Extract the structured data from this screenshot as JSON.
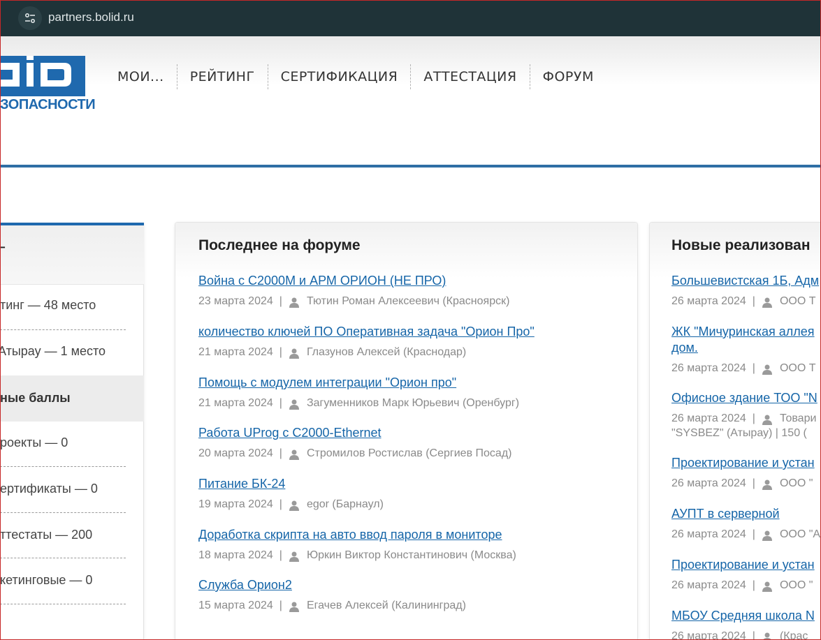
{
  "browser": {
    "url": "partners.bolid.ru"
  },
  "header": {
    "logo_letters": "LID",
    "logo_tagline": "ЗОПАСНОСТИ",
    "nav": [
      "МОИ...",
      "РЕЙТИНГ",
      "СЕРТИФИКАЦИЯ",
      "АТТЕСТАЦИЯ",
      "ФОРУМ"
    ]
  },
  "left_panel": {
    "title": "Г",
    "rows": [
      "тинг — 48 место",
      "Атырау — 1 место"
    ],
    "section": "ные баллы",
    "points": [
      "роекты — 0",
      "ертификаты — 0",
      "ттестаты — 200",
      "кетинговые — 0"
    ]
  },
  "forum": {
    "title": "Последнее на форуме",
    "items": [
      {
        "title": "Война с С2000М и АРМ ОРИОН (НЕ ПРО)",
        "date": "23 марта 2024",
        "author": "Тютин Роман Алексеевич (Красноярск)"
      },
      {
        "title": "количество ключей ПО Оперативная задача \"Орион Про\"",
        "date": "21 марта 2024",
        "author": "Глазунов Алексей (Краснодар)"
      },
      {
        "title": "Помощь с модулем интеграции \"Орион про\"",
        "date": "21 марта 2024",
        "author": "Загуменников Марк Юрьевич (Оренбург)"
      },
      {
        "title": "Работа UProg с С2000-Ethernet",
        "date": "20 марта 2024",
        "author": "Стромилов Ростислав (Сергиев Посад)"
      },
      {
        "title": "Питание БК-24",
        "date": "19 марта 2024",
        "author": "egor (Барнаул)"
      },
      {
        "title": "Доработка скрипта на авто ввод пароля в мониторе",
        "date": "18 марта 2024",
        "author": "Юркин Виктор Константинович (Москва)"
      },
      {
        "title": "Служба Орион2",
        "date": "15 марта 2024",
        "author": "Егачев Алексей (Калининград)"
      }
    ]
  },
  "implemented": {
    "title": "Новые реализован",
    "items": [
      {
        "title": "Большевистская 1Б, Адм",
        "date": "26 марта 2024",
        "author": "ООО Т"
      },
      {
        "title": "ЖК \"Мичуринская аллея",
        "title2": "дом.",
        "date": "26 марта 2024",
        "author": "ООО Т"
      },
      {
        "title": "Офисное здание ТОО \"N",
        "date": "26 марта 2024",
        "author": "Товари",
        "author2": "\"SYSBEZ\" (Атырау)  |  150 ("
      },
      {
        "title": "Проектирование и устан",
        "date": "26 марта 2024",
        "author": "ООО \""
      },
      {
        "title": "АУПТ в серверной",
        "date": "26 марта 2024",
        "author": "ООО \"А"
      },
      {
        "title": "Проектирование и устан",
        "date": "26 марта 2024",
        "author": "ООО \""
      },
      {
        "title": "МБОУ Средняя школа N",
        "date": "26 марта 2024",
        "author": "(Крас"
      }
    ]
  }
}
